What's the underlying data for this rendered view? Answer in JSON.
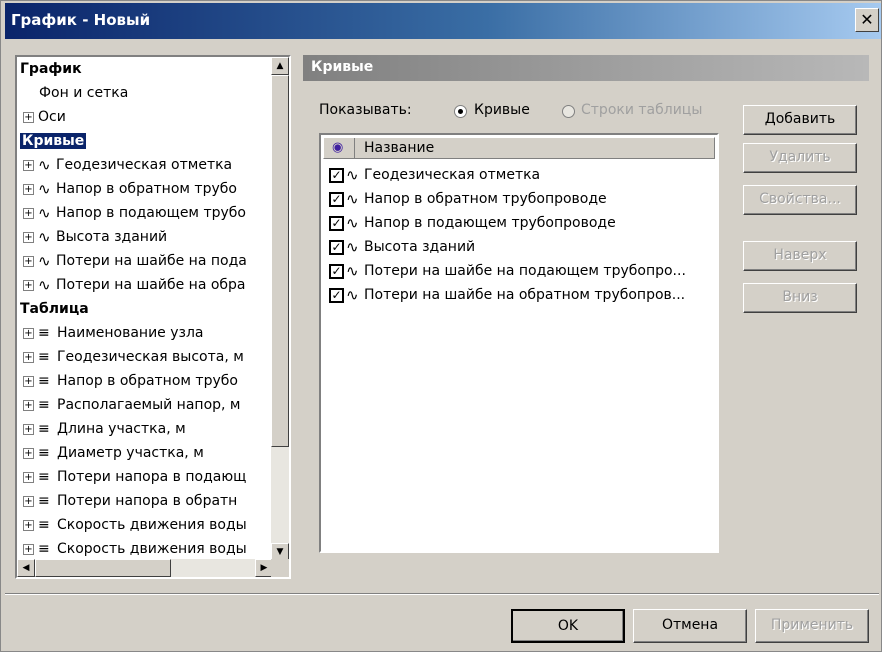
{
  "window": {
    "title": "График - Новый",
    "close_glyph": "✕"
  },
  "tree": {
    "sections": [
      {
        "label": "График"
      },
      {
        "label": "Кривые"
      },
      {
        "label": "Таблица"
      }
    ],
    "graph_items": [
      "Фон и сетка",
      "Оси"
    ],
    "curve_items": [
      "Геодезическая отметка",
      "Напор в обратном трубо",
      "Напор в подающем трубо",
      "Высота зданий",
      "Потери на шайбе на пода",
      "Потери на шайбе на обра"
    ],
    "table_items": [
      "Наименование узла",
      "Геодезическая высота, м",
      "Напор в обратном трубо",
      "Располагаемый напор, м",
      "Длина участка, м",
      "Диаметр участка, м",
      "Потери напора в подающ",
      "Потери напора в обратн",
      "Скорость движения воды",
      "Скорость движения воды"
    ]
  },
  "panel": {
    "title": "Кривые",
    "show_label": "Показывать:",
    "radio_curves": "Кривые",
    "radio_rows": "Строки таблицы",
    "column_name": "Название",
    "rows": [
      "Геодезическая отметка",
      "Напор в обратном трубопроводе",
      "Напор в подающем трубопроводе",
      "Высота зданий",
      "Потери на шайбе на подающем трубопро...",
      "Потери на шайбе на обратном трубопров..."
    ]
  },
  "side_buttons": {
    "add": "Добавить",
    "delete": "Удалить",
    "properties": "Свойства...",
    "up": "Наверх",
    "down": "Вниз"
  },
  "footer_buttons": {
    "ok": "OK",
    "cancel": "Отмена",
    "apply": "Применить"
  },
  "icons": {
    "expand": "+",
    "curve": "∿",
    "table": "≡",
    "eye": "◉",
    "check": "✓"
  },
  "colors": {
    "title_gradient_start": "#0a246a",
    "selection": "#0a246a",
    "panel_header": "#808080"
  }
}
